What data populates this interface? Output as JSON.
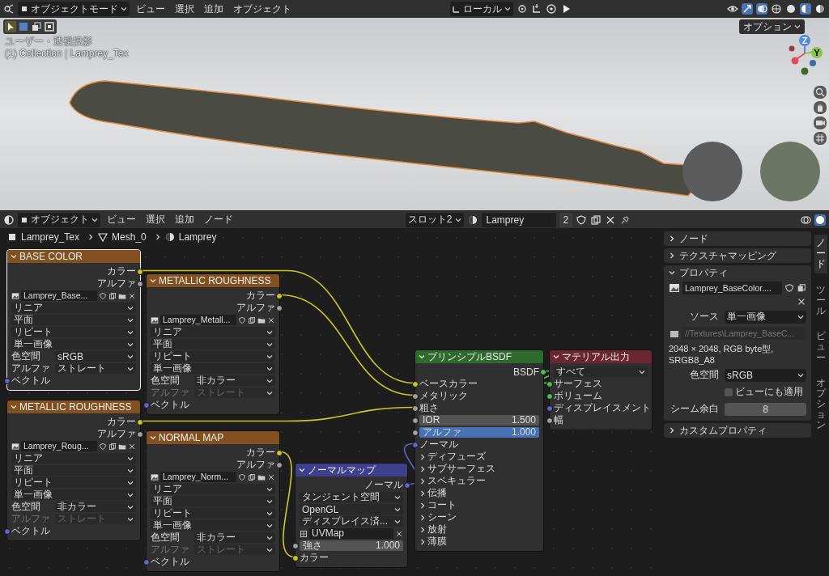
{
  "top_bar": {
    "mode_menu": "オブジェクトモード",
    "menus": [
      "ビュー",
      "選択",
      "追加",
      "オブジェクト"
    ],
    "orientation_menu": "ローカル",
    "options_button": "オプション"
  },
  "viewport": {
    "view_label": "ユーザー・透視投影",
    "collection_label": "(1) Collection | Lamprey_Tex",
    "gizmo_labels": [
      "Z",
      "Y"
    ]
  },
  "node_header": {
    "mode_menu": "オブジェクト",
    "menus": [
      "ビュー",
      "選択",
      "追加",
      "ノード"
    ],
    "slot_menu": "スロット2",
    "material": "Lamprey",
    "users": "2"
  },
  "breadcrumb": [
    "Lamprey_Tex",
    "Mesh_0",
    "Lamprey"
  ],
  "image_nodes": [
    {
      "title": "BASE COLOR",
      "selected": true,
      "outputs": [
        "カラー",
        "アルファ"
      ],
      "image": "Lamprey_Base...",
      "interpolation": "リニア",
      "projection": "平面",
      "extension": "リピート",
      "source": "単一画像",
      "color_space_label": "色空間",
      "color_space": "sRGB",
      "alpha_label": "アルファ",
      "alpha_mode": "ストレート",
      "alpha_disabled": false,
      "input": "ベクトル"
    },
    {
      "title": "METALLIC ROUGHNESS",
      "selected": false,
      "outputs": [
        "カラー",
        "アルファ"
      ],
      "image": "Lamprey_Metall...",
      "interpolation": "リニア",
      "projection": "平面",
      "extension": "リピート",
      "source": "単一画像",
      "color_space_label": "色空間",
      "color_space": "非カラー",
      "alpha_label": "アルファ",
      "alpha_mode": "ストレート",
      "alpha_disabled": true,
      "input": "ベクトル"
    },
    {
      "title": "METALLIC ROUGHNESS",
      "selected": false,
      "outputs": [
        "カラー",
        "アルファ"
      ],
      "image": "Lamprey_Roug...",
      "interpolation": "リニア",
      "projection": "平面",
      "extension": "リピート",
      "source": "単一画像",
      "color_space_label": "色空間",
      "color_space": "非カラー",
      "alpha_label": "アルファ",
      "alpha_mode": "ストレート",
      "alpha_disabled": true,
      "input": "ベクトル"
    },
    {
      "title": "NORMAL MAP",
      "selected": false,
      "outputs": [
        "カラー",
        "アルファ"
      ],
      "image": "Lamprey_Norm...",
      "interpolation": "リニア",
      "projection": "平面",
      "extension": "リピート",
      "source": "単一画像",
      "color_space_label": "色空間",
      "color_space": "非カラー",
      "alpha_label": "アルファ",
      "alpha_mode": "ストレート",
      "alpha_disabled": true,
      "input": "ベクトル"
    }
  ],
  "normal_map_node": {
    "title": "ノーマルマップ",
    "output": "ノーマル",
    "space": "タンジェント空間",
    "convention": "OpenGL",
    "mode": "ディスプレイス済...",
    "uv_map": "UVMap",
    "strength_label": "強さ",
    "strength": "1.000",
    "input": "カラー"
  },
  "principled_node": {
    "title": "プリンシプルBSDF",
    "output": "BSDF",
    "inputs": [
      "ベースカラー",
      "メタリック",
      "粗さ"
    ],
    "ior_label": "IOR",
    "ior": "1.500",
    "alpha_label": "アルファ",
    "alpha": "1.000",
    "normal": "ノーマル",
    "panels": [
      "ディフューズ",
      "サブサーフェス",
      "スペキュラー",
      "伝播",
      "コート",
      "シーン",
      "放射",
      "薄膜"
    ]
  },
  "output_node": {
    "title": "マテリアル出力",
    "target": "すべて",
    "inputs": [
      "サーフェス",
      "ボリューム",
      "ディスプレイスメント",
      "幅"
    ]
  },
  "sidebar": {
    "sections": [
      {
        "title": "ノード",
        "expanded": false
      },
      {
        "title": "テクスチャマッピング",
        "expanded": false
      },
      {
        "title": "プロパティ",
        "expanded": true
      },
      {
        "title": "カスタムプロパティ",
        "expanded": false
      }
    ],
    "properties": {
      "image": "Lamprey_BaseColor....",
      "source_label": "ソース",
      "source": "単一画像",
      "filepath": "//Textures\\Lamprey_BaseC...",
      "info": "2048 × 2048,  RGB byte型, SRGB8_A8",
      "color_space_label": "色空間",
      "color_space": "sRGB",
      "view_apply": {
        "label": "ビューにも適用",
        "checked": false
      },
      "seam_label": "シーム余白",
      "seam": "8"
    },
    "tabs": [
      {
        "label": "ノード",
        "selected": true
      },
      {
        "label": "ツール",
        "selected": false
      },
      {
        "label": "ビュー",
        "selected": false
      },
      {
        "label": "オプション",
        "selected": false
      }
    ]
  }
}
